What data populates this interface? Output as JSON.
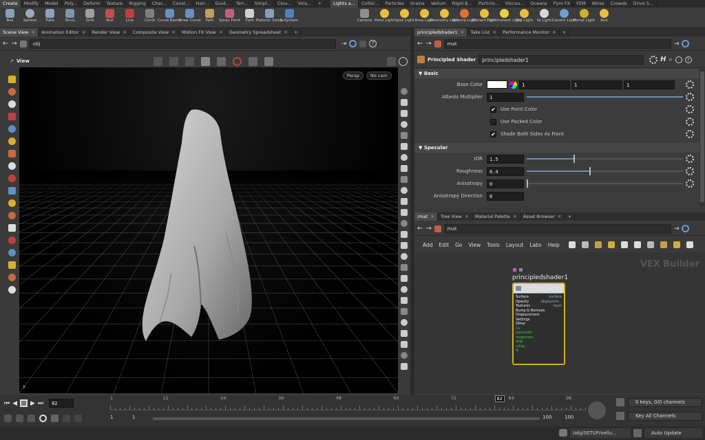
{
  "shelf": {
    "left_tabs": [
      "Create",
      "Modify",
      "Model",
      "Poly...",
      "Deform",
      "Texture",
      "Rigging",
      "Char...",
      "Const...",
      "Hair...",
      "Guid...",
      "Terr...",
      "Simpl...",
      "Clou...",
      "Volu..."
    ],
    "right_tabs": [
      "Lights a...",
      "Collisi...",
      "Particles",
      "Grains",
      "Vellum",
      "Rigid B...",
      "Particle...",
      "Viscou...",
      "Oceans",
      "Pyro FX",
      "FEM",
      "Wires",
      "Crowds",
      "Drive S..."
    ],
    "left_tools": [
      {
        "label": "Box",
        "icon": "box-icon",
        "color": "#8aa0b8"
      },
      {
        "label": "Sphere",
        "icon": "sphere-icon",
        "color": "#9aa8b8"
      },
      {
        "label": "Tube",
        "icon": "tube-icon",
        "color": "#8fa3b8"
      },
      {
        "label": "Torus",
        "icon": "torus-icon",
        "color": "#7f95aa"
      },
      {
        "label": "Grid",
        "icon": "grid-icon",
        "color": "#a0a0a0"
      },
      {
        "label": "Null",
        "icon": "null-icon",
        "color": "#c05050"
      },
      {
        "label": "Line",
        "icon": "line-icon",
        "color": "#c04040"
      },
      {
        "label": "Circle",
        "icon": "circle-icon",
        "color": "#808080"
      },
      {
        "label": "Curve Bezier",
        "icon": "bezier-icon",
        "color": "#6a8fc0"
      },
      {
        "label": "Draw Curve",
        "icon": "draw-curve-icon",
        "color": "#6a8fc0"
      },
      {
        "label": "Path",
        "icon": "path-icon",
        "color": "#c0a060"
      },
      {
        "label": "Spray Paint",
        "icon": "spray-paint-icon",
        "color": "#c06080"
      },
      {
        "label": "Font",
        "icon": "font-icon",
        "color": "#d0d0d0"
      },
      {
        "label": "Platonic Solids",
        "icon": "platonic-icon",
        "color": "#8aa0b8"
      },
      {
        "label": "L-System",
        "icon": "lsystem-icon",
        "color": "#5080c0"
      }
    ],
    "right_tools": [
      {
        "label": "Camera",
        "icon": "camera-icon",
        "color": "#909090"
      },
      {
        "label": "Point Light",
        "icon": "point-light-icon",
        "color": "#e8c040"
      },
      {
        "label": "Spot Light",
        "icon": "spot-light-icon",
        "color": "#e8c040"
      },
      {
        "label": "Area Light",
        "icon": "area-light-icon",
        "color": "#e8c040"
      },
      {
        "label": "Geometry Light",
        "icon": "geometry-light-icon",
        "color": "#e8c040"
      },
      {
        "label": "Volume Light",
        "icon": "volume-light-icon",
        "color": "#e07030"
      },
      {
        "label": "Distant Light",
        "icon": "distant-light-icon",
        "color": "#e8c040"
      },
      {
        "label": "Environment Light",
        "icon": "environment-light-icon",
        "color": "#e8d040"
      },
      {
        "label": "Sky Light",
        "icon": "sky-light-icon",
        "color": "#e8c040"
      },
      {
        "label": "GI Light",
        "icon": "gi-light-icon",
        "color": "#d8d8d8"
      },
      {
        "label": "Caustic Light",
        "icon": "caustic-light-icon",
        "color": "#70a0d0"
      },
      {
        "label": "Portal Light",
        "icon": "portal-light-icon",
        "color": "#d0b030"
      },
      {
        "label": "Ami",
        "icon": "ambient-light-icon",
        "color": "#e8c040"
      }
    ]
  },
  "left_pane": {
    "tabs": [
      "Scene View",
      "Animation Editor",
      "Render View",
      "Composite View",
      "Motion FX View",
      "Geometry Spreadsheet"
    ],
    "path": "obj",
    "view_label": "View",
    "persp": "Persp",
    "cam": "No cam"
  },
  "param_pane": {
    "tabs": [
      "principledshader1",
      "Take List",
      "Performance Monitor"
    ],
    "path": "mat",
    "node_type": "Principled Shader",
    "node_name": "principledshader1",
    "sections": {
      "basic": "Basic",
      "specular": "Specular"
    },
    "base_color": {
      "label": "Base Color",
      "r": "1",
      "g": "1",
      "b": "1"
    },
    "albedo": {
      "label": "Albedo Multiplier",
      "value": "1"
    },
    "checks": [
      {
        "label": "Use Point Color",
        "checked": true
      },
      {
        "label": "Use Packed Color",
        "checked": false
      },
      {
        "label": "Shade Both Sides As Front",
        "checked": true
      }
    ],
    "ior": {
      "label": "IOR",
      "value": "1.5",
      "level": 0.3
    },
    "roughness": {
      "label": "Roughness",
      "value": "0.4",
      "level": 0.4
    },
    "anisotropy": {
      "label": "Anisotropy",
      "value": "0",
      "level": 0
    },
    "aniso_dir": {
      "label": "Anisotropy Direction",
      "value": "0"
    }
  },
  "network_pane": {
    "tabs": [
      "/mat",
      "Tree View",
      "Material Palette",
      "Asset Browser"
    ],
    "path": "mat",
    "menu": [
      "Add",
      "Edit",
      "Go",
      "View",
      "Tools",
      "Layout",
      "Labs",
      "Help"
    ],
    "watermark": "VEX Builder",
    "node_title": "principledshader1",
    "inputs_white": [
      "Surface",
      "Opacity",
      "Textures",
      "Bump & Normals",
      "Displacement",
      "Settings",
      "Other"
    ],
    "inputs_green": [
      "Ce",
      "basecolor",
      "roughness",
      "disp",
      "vdisp",
      "N"
    ],
    "outputs": [
      "surface",
      "displacem...",
      "layer"
    ]
  },
  "timeline": {
    "frame": "82",
    "ticks": [
      "1",
      "12",
      "24",
      "36",
      "48",
      "60",
      "72",
      "84",
      "96"
    ],
    "current_marker": "82",
    "start": "1",
    "start2": "1",
    "end": "100",
    "end2": "100",
    "keys": "0 keys, 0/0 channels",
    "key_mode": "Key All Channels"
  },
  "status": {
    "path": "/obj/SETUP/vellu...",
    "update": "Auto Update"
  },
  "colors": {
    "accent": "#e8c040",
    "node_border": "#d0b020",
    "green_input": "#50c050"
  }
}
